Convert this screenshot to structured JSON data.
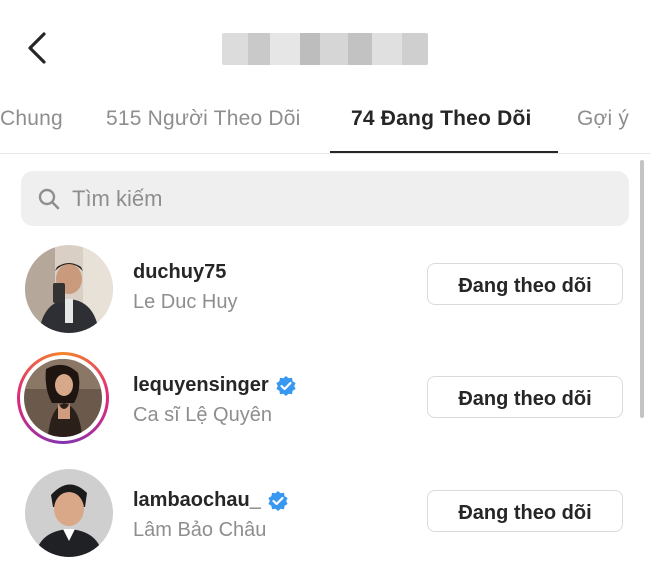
{
  "header": {
    "back_icon": "chevron-left-icon",
    "title_blurred": true
  },
  "tabs": [
    {
      "label": "Chung",
      "active": false
    },
    {
      "label": "515 Người Theo Dõi",
      "active": false
    },
    {
      "label": "74 Đang Theo Dõi",
      "active": true
    },
    {
      "label": "Gợi ý",
      "active": false
    }
  ],
  "search": {
    "icon": "search-icon",
    "placeholder": "Tìm kiếm"
  },
  "users": [
    {
      "username": "duchuy75",
      "full_name": "Le Duc Huy",
      "verified": false,
      "story_ring": false,
      "button_label": "Đang theo dõi"
    },
    {
      "username": "lequyensinger",
      "full_name": "Ca sĩ Lệ Quyên",
      "verified": true,
      "story_ring": true,
      "button_label": "Đang theo dõi"
    },
    {
      "username": "lambaochau_",
      "full_name": "Lâm Bảo Châu",
      "verified": true,
      "story_ring": false,
      "button_label": "Đang theo dõi"
    }
  ],
  "colors": {
    "text": "#262626",
    "secondary": "#8e8e8e",
    "verified": "#3897f0",
    "search_bg": "#efefef"
  }
}
